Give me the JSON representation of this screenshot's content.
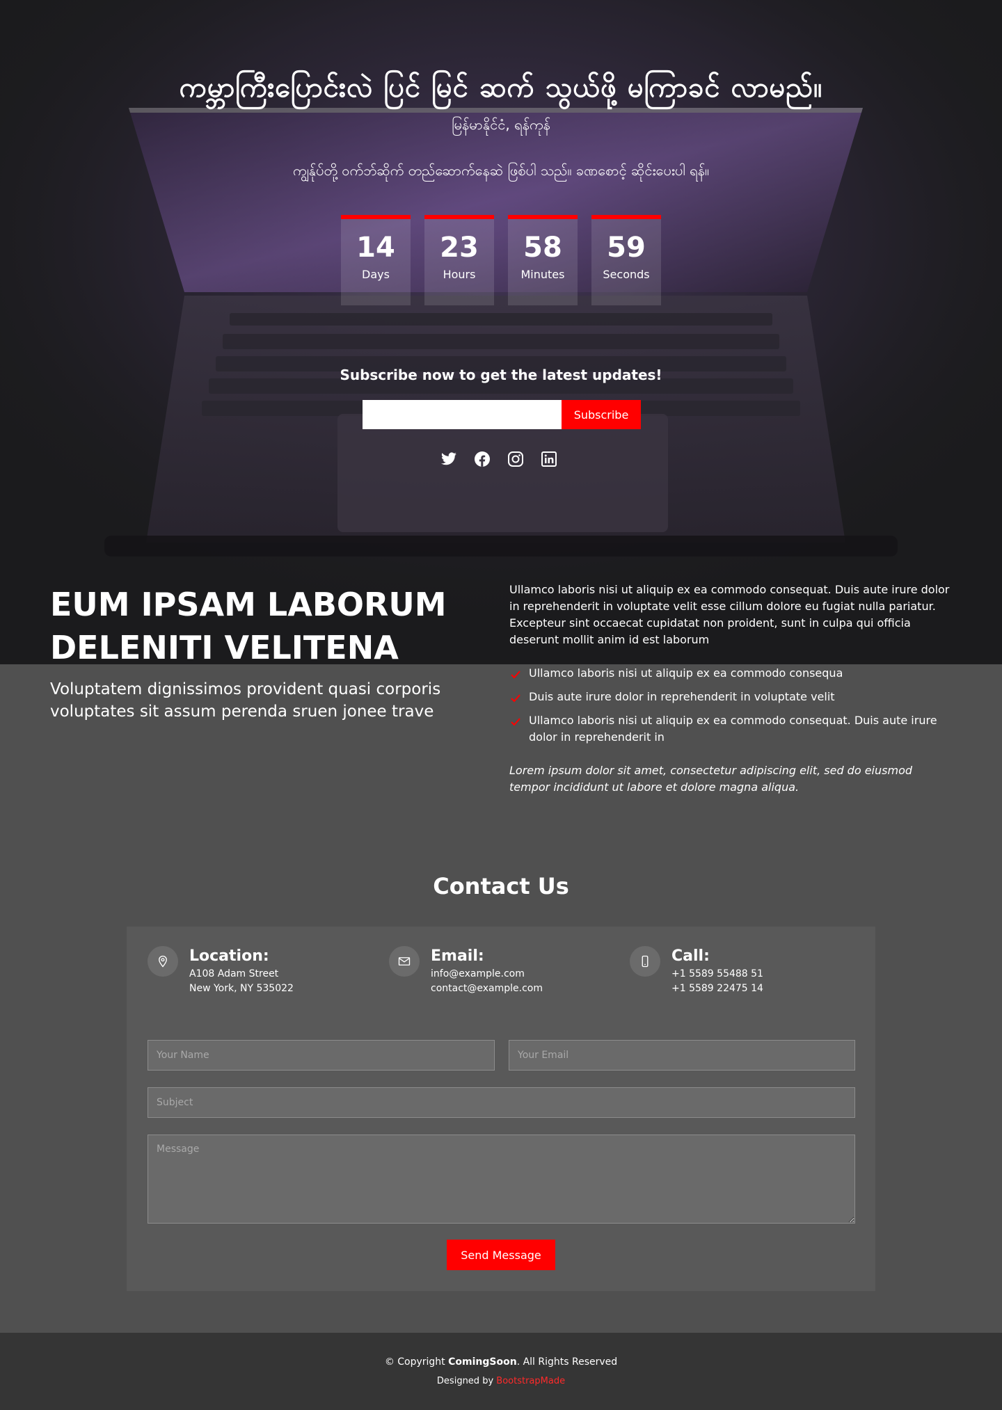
{
  "colors": {
    "accent": "#ff0000",
    "hero_bg": "#1b1b1d",
    "section_bg": "#505050",
    "panel_bg": "#595959",
    "footer_bg": "#353535"
  },
  "hero": {
    "title": "ကမ္ဘာကြီးပြောင်းလဲ ပြင် မြင် ဆက် သွယ်ဖို့ မကြာခင် လာမည်။",
    "subtitle": "မြန်မာနိုင်ငံ, ရန်ကုန်",
    "description": "ကျွန်ုပ်တို့ ဝက်ဘ်ဆိုက် တည်ဆောက်နေဆဲ ဖြစ်ပါ သည်။ ခဏစောင့် ဆိုင်းပေးပါ ရန်။",
    "countdown": [
      {
        "value": "14",
        "label": "Days"
      },
      {
        "value": "23",
        "label": "Hours"
      },
      {
        "value": "58",
        "label": "Minutes"
      },
      {
        "value": "59",
        "label": "Seconds"
      }
    ],
    "subscribe_heading": "Subscribe now to get the latest updates!",
    "subscribe_button": "Subscribe",
    "email_value": "",
    "socials": [
      "twitter-icon",
      "facebook-icon",
      "instagram-icon",
      "linkedin-icon"
    ]
  },
  "about": {
    "title": "EUM IPSAM LABORUM DELENITI VELITENA",
    "lead": "Voluptatem dignissimos provident quasi corporis voluptates sit assum perenda sruen jonee trave",
    "paragraph": "Ullamco laboris nisi ut aliquip ex ea commodo consequat. Duis aute irure dolor in reprehenderit in voluptate velit esse cillum dolore eu fugiat nulla pariatur. Excepteur sint occaecat cupidatat non proident, sunt in culpa qui officia deserunt mollit anim id est laborum",
    "list": [
      "Ullamco laboris nisi ut aliquip ex ea commodo consequa",
      "Duis aute irure dolor in reprehenderit in voluptate velit",
      "Ullamco laboris nisi ut aliquip ex ea commodo consequat. Duis aute irure dolor in reprehenderit in"
    ],
    "italic": "Lorem ipsum dolor sit amet, consectetur adipiscing elit, sed do eiusmod tempor incididunt ut labore et dolore magna aliqua."
  },
  "contact": {
    "title": "Contact Us",
    "location": {
      "heading": "Location:",
      "line1": "A108 Adam Street",
      "line2": "New York, NY 535022"
    },
    "email": {
      "heading": "Email:",
      "line1": "info@example.com",
      "line2": "contact@example.com"
    },
    "call": {
      "heading": "Call:",
      "line1": "+1 5589 55488 51",
      "line2": "+1 5589 22475 14"
    },
    "form": {
      "name_placeholder": "Your Name",
      "email_placeholder": "Your Email",
      "subject_placeholder": "Subject",
      "message_placeholder": "Message",
      "send_label": "Send Message"
    }
  },
  "footer": {
    "copyright_prefix": "© Copyright ",
    "brand": "ComingSoon",
    "copyright_suffix": ". All Rights Reserved",
    "designed_by": "Designed by ",
    "designer": "BootstrapMade"
  }
}
